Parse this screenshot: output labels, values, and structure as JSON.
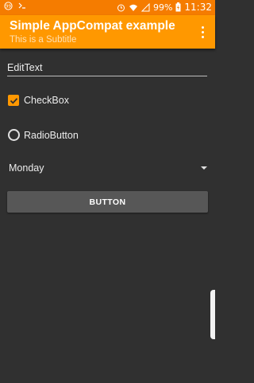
{
  "status_bar": {
    "battery": "99%",
    "time": "11:32"
  },
  "toolbar": {
    "title": "Simple AppCompat example",
    "subtitle": "This is a Subtitle"
  },
  "form": {
    "edittext_value": "EditText",
    "checkbox_label": "CheckBox",
    "checkbox_checked": true,
    "radio_label": "RadioButton",
    "radio_checked": false,
    "spinner_value": "Monday",
    "button_label": "BUTTON"
  },
  "colors": {
    "status_bar": "#F57C00",
    "toolbar": "#FF9800",
    "background": "#303030",
    "accent": "#FF9800"
  }
}
